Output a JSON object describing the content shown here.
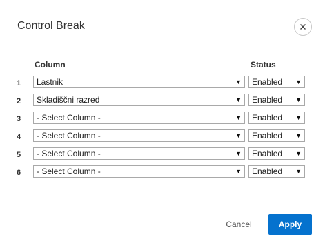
{
  "dialog": {
    "title": "Control Break",
    "close_icon": "close-icon"
  },
  "table": {
    "headers": {
      "column": "Column",
      "status": "Status"
    },
    "rows": [
      {
        "num": "1",
        "column": "Lastnik",
        "status": "Enabled"
      },
      {
        "num": "2",
        "column": "Skladiščni razred",
        "status": "Enabled"
      },
      {
        "num": "3",
        "column": "- Select Column -",
        "status": "Enabled"
      },
      {
        "num": "4",
        "column": "- Select Column -",
        "status": "Enabled"
      },
      {
        "num": "5",
        "column": "- Select Column -",
        "status": "Enabled"
      },
      {
        "num": "6",
        "column": "- Select Column -",
        "status": "Enabled"
      }
    ]
  },
  "footer": {
    "cancel_label": "Cancel",
    "apply_label": "Apply"
  },
  "colors": {
    "apply_bg": "#0572ce",
    "border": "#a9a9a9"
  }
}
